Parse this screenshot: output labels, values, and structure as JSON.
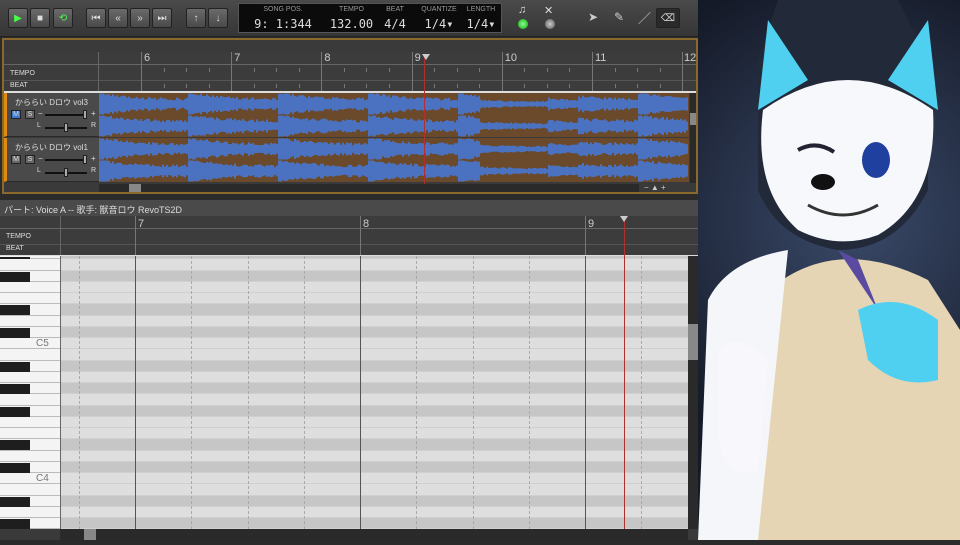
{
  "toolbar": {
    "buttons": [
      "play",
      "stop",
      "loop",
      "rewind-start",
      "rewind",
      "fast-forward",
      "forward-end",
      "insert-bar",
      "delete-bar"
    ],
    "song_pos_label": "SONG POS.",
    "song_pos": "9: 1:344",
    "tempo_label": "TEMPO",
    "tempo": "132.00",
    "beat_label": "BEAT",
    "beat": "4/4",
    "quantize_label": "QUANTIZE",
    "quantize": "1/4▾",
    "length_label": "LENGTH",
    "length": "1/4▾"
  },
  "upper": {
    "tempo_label": "TEMPO",
    "beat_label": "BEAT",
    "measures": [
      "6",
      "7",
      "8",
      "9",
      "10",
      "11",
      "12"
    ],
    "tracks": [
      {
        "name": "かららい Dロウ vol3",
        "mute": "M",
        "solo": "S",
        "minus": "−",
        "plus": "+",
        "l": "L",
        "r": "R",
        "muted": true
      },
      {
        "name": "かららい Dロウ vol1",
        "mute": "M",
        "solo": "S",
        "minus": "−",
        "plus": "+",
        "l": "L",
        "r": "R",
        "muted": false
      }
    ]
  },
  "lower": {
    "part_header": "パート: Voice A  --  歌手: 獣音ロウ RevoTS2D",
    "tempo_label": "TEMPO",
    "beat_label": "BEAT",
    "measures": [
      "7",
      "8",
      "9"
    ],
    "key_labels": {
      "c5": "C5",
      "c4": "C4"
    }
  },
  "colors": {
    "wave_blue": "#4a72c0",
    "wave_brown": "#6a4a2a",
    "accent": "#e08a10",
    "playhead": "#b03030"
  }
}
